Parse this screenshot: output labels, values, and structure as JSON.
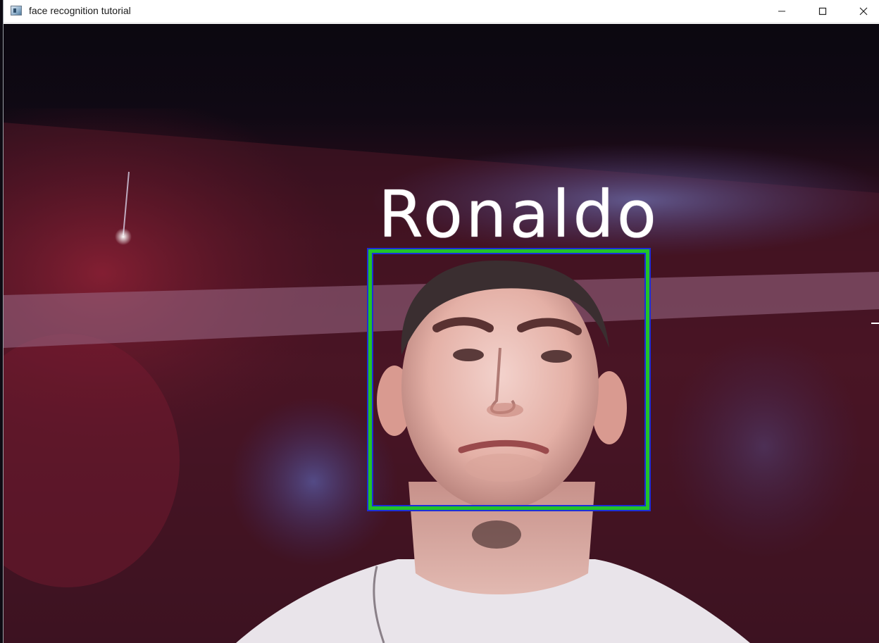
{
  "window": {
    "title": "face recognition tutorial",
    "icon": "app-window-icon",
    "controls": {
      "minimize_icon": "minimize-icon",
      "maximize_icon": "maximize-icon",
      "close_icon": "close-icon"
    }
  },
  "video": {
    "detection": {
      "label": "Ronaldo",
      "box_color": "#22c32a",
      "box_outline_color": "#1c2fd9",
      "label_color": "#ffffff"
    }
  }
}
